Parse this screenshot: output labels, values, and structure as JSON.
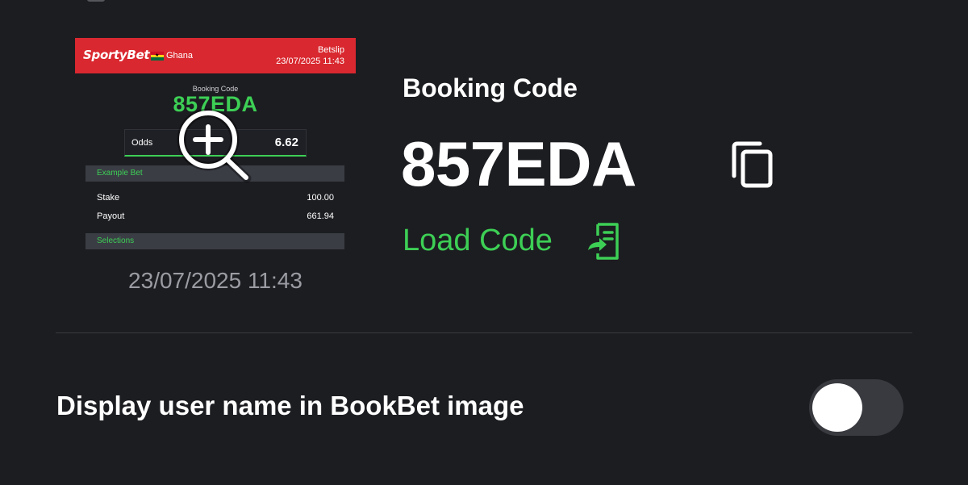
{
  "preview": {
    "brand": "SportyBet",
    "country": "Ghana",
    "betslip_label": "Betslip",
    "date": "23/07/2025 11:43",
    "booking_code_label": "Booking Code",
    "booking_code": "857EDA",
    "odds_label": "Odds",
    "odds_value": "6.62",
    "example_bet_label": "Example Bet",
    "stake_label": "Stake",
    "stake_value": "100.00",
    "payout_label": "Payout",
    "payout_value": "661.94",
    "selections_label": "Selections",
    "caption_date": "23/07/2025 11:43"
  },
  "booking": {
    "title": "Booking Code",
    "code": "857EDA",
    "load_code_label": "Load Code"
  },
  "settings": {
    "display_username_label": "Display user name in BookBet image",
    "display_username_enabled": false
  },
  "colors": {
    "background": "#1c1d21",
    "accent_green": "#3dcf55",
    "brand_red": "#d9282f",
    "muted_text": "#9b9ca3"
  },
  "icons": {
    "zoom": "zoom-in-icon",
    "copy": "copy-icon",
    "load": "ticket-load-icon",
    "flag": "ghana-flag-icon"
  }
}
